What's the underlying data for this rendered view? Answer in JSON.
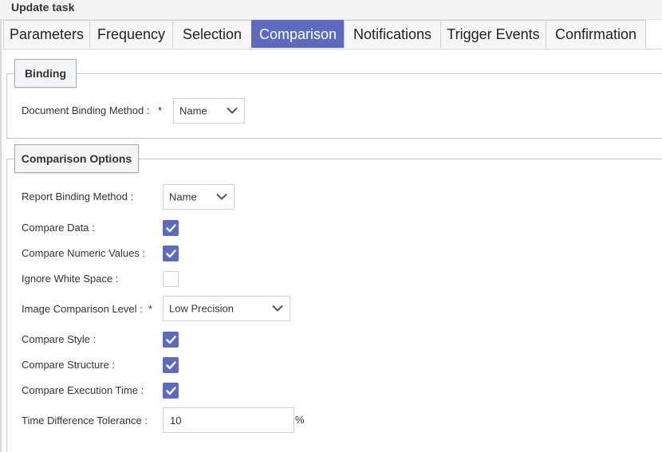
{
  "window": {
    "title": "Update task"
  },
  "tabs": [
    {
      "label": "Parameters",
      "active": false
    },
    {
      "label": "Frequency",
      "active": false
    },
    {
      "label": "Selection",
      "active": false
    },
    {
      "label": "Comparison",
      "active": true
    },
    {
      "label": "Notifications",
      "active": false
    },
    {
      "label": "Trigger Events",
      "active": false
    },
    {
      "label": "Confirmation",
      "active": false
    }
  ],
  "binding": {
    "legend": "Binding",
    "document_binding_method": {
      "label": "Document Binding Method :",
      "required_mark": "*",
      "value": "Name"
    }
  },
  "comparison_options": {
    "legend": "Comparison Options",
    "report_binding_method": {
      "label": "Report Binding Method :",
      "value": "Name"
    },
    "compare_data": {
      "label": "Compare Data :",
      "checked": true
    },
    "compare_numeric_values": {
      "label": "Compare Numeric Values :",
      "checked": true
    },
    "ignore_white_space": {
      "label": "Ignore White Space :",
      "checked": false
    },
    "image_comparison_level": {
      "label": "Image Comparison Level :",
      "required_mark": "*",
      "value": "Low Precision"
    },
    "compare_style": {
      "label": "Compare Style :",
      "checked": true
    },
    "compare_structure": {
      "label": "Compare Structure :",
      "checked": true
    },
    "compare_execution_time": {
      "label": "Compare Execution Time :",
      "checked": true
    },
    "time_difference_tolerance": {
      "label": "Time Difference Tolerance :",
      "value": "10",
      "unit": "%"
    }
  },
  "colors": {
    "accent": "#5c6bc0",
    "tab_inactive_bg": "#f6f6f6",
    "border": "#d0d0d0"
  },
  "icons": {
    "select_caret": "chevron-down-icon",
    "checkbox_mark": "checkmark-icon"
  }
}
